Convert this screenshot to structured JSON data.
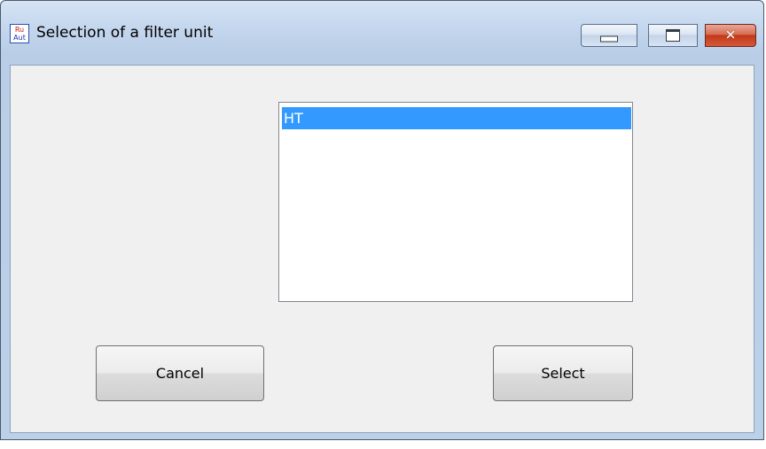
{
  "window": {
    "title": "Selection of a filter unit",
    "icon": {
      "name": "app-icon",
      "text_line1": "Ru",
      "text_line2": "Aut"
    },
    "caption_buttons": {
      "minimize": "minimize-icon",
      "maximize": "maximize-icon",
      "close": "close-icon",
      "close_glyph": "✕"
    }
  },
  "filter_units": {
    "items": [
      {
        "label": "HT",
        "selected": true
      }
    ]
  },
  "buttons": {
    "cancel_label": "Cancel",
    "select_label": "Select"
  },
  "colors": {
    "selection": "#3399ff",
    "dialog_background": "#f0f0f0",
    "close_button": "#c2381a"
  }
}
